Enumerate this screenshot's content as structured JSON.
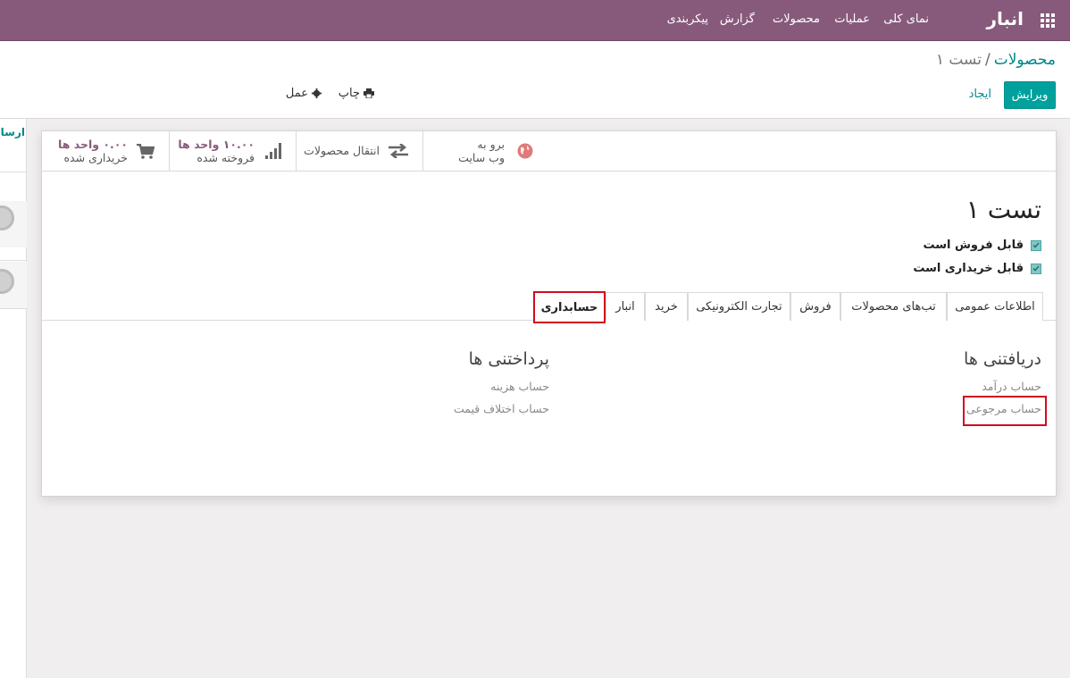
{
  "topbar": {
    "app_title": "انبار",
    "menu": [
      "نمای کلی",
      "عملیات",
      "محصولات",
      "گزارش",
      "پیکربندی"
    ]
  },
  "breadcrumb": {
    "parent": "محصولات",
    "separator": "/",
    "current": "تست ۱"
  },
  "buttons": {
    "edit": "ویرایش",
    "create": "ایجاد",
    "print": "چاپ",
    "action": "عمل"
  },
  "left_panel": {
    "label": "ارسال"
  },
  "stat_buttons": {
    "website": {
      "line1": "برو به",
      "line2": "وب سایت"
    },
    "moves": {
      "label": "انتقال محصولات"
    },
    "sold": {
      "value": "۱۰.۰۰ واحد ها",
      "label": "فروخته شده"
    },
    "purchased": {
      "value": "۰.۰۰ واحد ها",
      "label": "خریداری شده"
    }
  },
  "record": {
    "name": "تست ۱",
    "sale_ok": "قابل فروش است",
    "purchase_ok": "قابل خریداری است"
  },
  "tabs": [
    "اطلاعات عمومی",
    "تب‌های محصولات",
    "فروش",
    "تجارت الکترونیکی",
    "خرید",
    "انبار",
    "حسابداری"
  ],
  "receivables": {
    "title": "دریافتنی ها",
    "income_account": "حساب درآمد",
    "refund_account": "حساب مرجوعی"
  },
  "payables": {
    "title": "پرداختنی ها",
    "expense_account": "حساب هزینه",
    "price_diff_account": "حساب اختلاف قیمت"
  },
  "colors": {
    "brand": "#875a7b",
    "primary": "#00a09d",
    "link": "#00878a",
    "highlight": "#d00c1e"
  }
}
